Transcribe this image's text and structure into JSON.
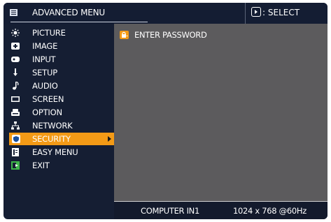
{
  "header": {
    "title": "ADVANCED MENU",
    "title_icon": "menu-icon",
    "select_hint": "SELECT",
    "select_icon": "select-button-icon"
  },
  "menu": {
    "items": [
      {
        "label": "PICTURE",
        "icon": "picture-icon"
      },
      {
        "label": "IMAGE",
        "icon": "image-icon"
      },
      {
        "label": "INPUT",
        "icon": "input-icon"
      },
      {
        "label": "SETUP",
        "icon": "setup-icon"
      },
      {
        "label": "AUDIO",
        "icon": "audio-icon"
      },
      {
        "label": "SCREEN",
        "icon": "screen-icon"
      },
      {
        "label": "OPTION",
        "icon": "option-icon"
      },
      {
        "label": "NETWORK",
        "icon": "network-icon"
      },
      {
        "label": "SECURITY",
        "icon": "security-icon",
        "selected": true
      },
      {
        "label": "EASY MENU",
        "icon": "easy-menu-icon"
      },
      {
        "label": "EXIT",
        "icon": "exit-icon"
      }
    ]
  },
  "content": {
    "items": [
      {
        "label": "ENTER PASSWORD",
        "icon": "password-lock-icon"
      }
    ]
  },
  "status": {
    "source": "COMPUTER IN1",
    "resolution": "1024 x 768 @60Hz"
  },
  "colors": {
    "background": "#151e33",
    "selected": "#f39a16",
    "content_panel": "#5c5b5d",
    "text": "#ffffff"
  }
}
